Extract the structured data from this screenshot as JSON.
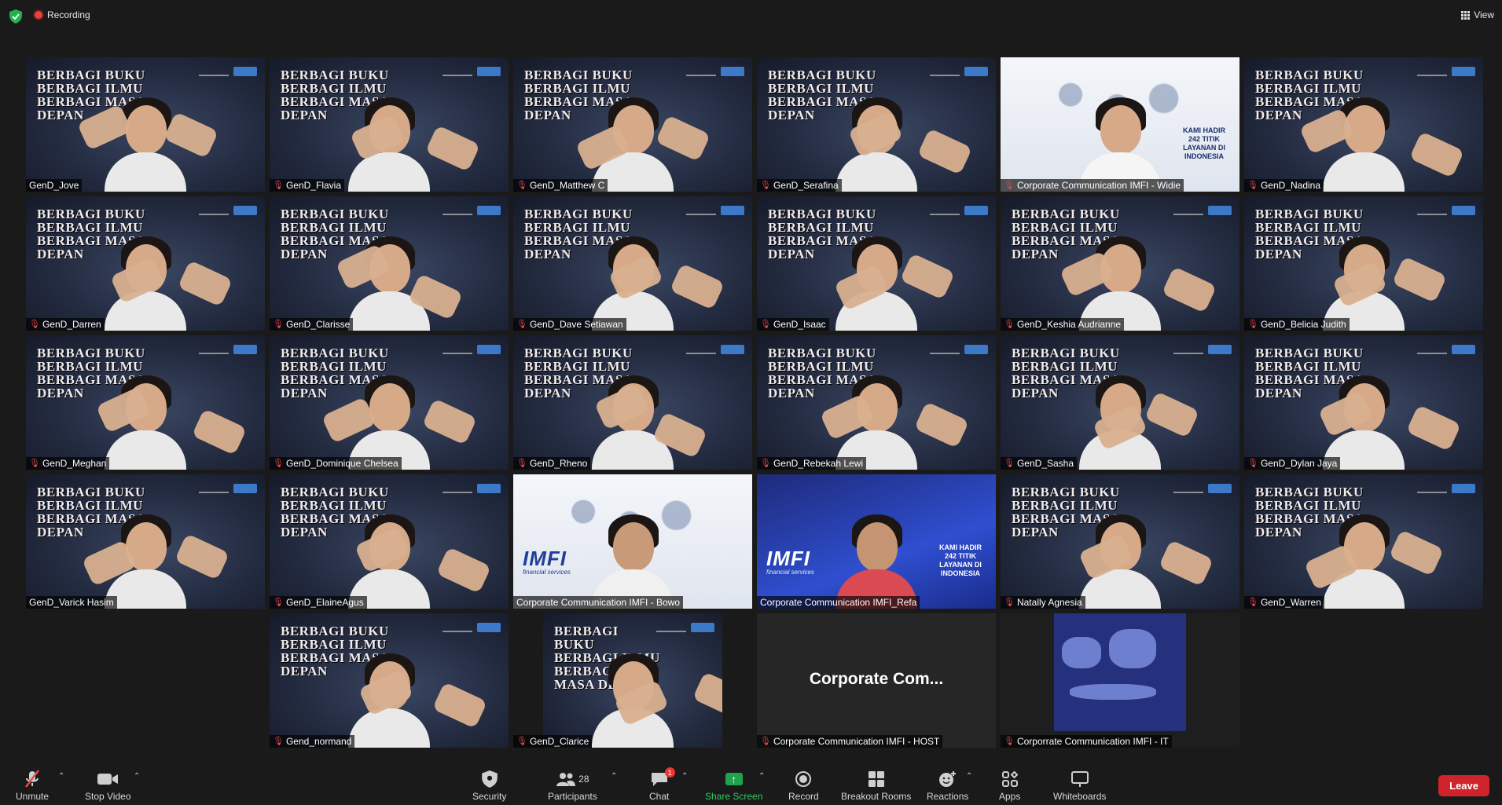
{
  "topbar": {
    "recording_label": "Recording",
    "view_label": "View"
  },
  "participants": [
    {
      "name": "GenD_Jove",
      "muted": false,
      "type": "person"
    },
    {
      "name": "GenD_Flavia",
      "muted": true,
      "type": "person"
    },
    {
      "name": "GenD_Matthew C",
      "muted": true,
      "type": "person"
    },
    {
      "name": "GenD_Serafina",
      "muted": true,
      "type": "person"
    },
    {
      "name": "Corporate Communication IMFI - Widie",
      "muted": true,
      "type": "map"
    },
    {
      "name": "GenD_Nadina",
      "muted": true,
      "type": "person"
    },
    {
      "name": "GenD_Darren",
      "muted": true,
      "type": "person"
    },
    {
      "name": "GenD_Clarisse",
      "muted": true,
      "type": "person"
    },
    {
      "name": "GenD_Dave Setiawan",
      "muted": true,
      "type": "person"
    },
    {
      "name": "GenD_Isaac",
      "muted": true,
      "type": "person"
    },
    {
      "name": "GenD_Keshia Audrianne",
      "muted": true,
      "type": "person"
    },
    {
      "name": "GenD_Belicia Judith",
      "muted": true,
      "type": "person"
    },
    {
      "name": "GenD_Meghan",
      "muted": true,
      "type": "person"
    },
    {
      "name": "GenD_Dominique Chelsea",
      "muted": true,
      "type": "person"
    },
    {
      "name": "GenD_Rheno",
      "muted": true,
      "type": "person"
    },
    {
      "name": "GenD_Rebekah Lewi",
      "muted": true,
      "type": "person"
    },
    {
      "name": "GenD_Sasha",
      "muted": true,
      "type": "person"
    },
    {
      "name": "GenD_Dylan Jaya",
      "muted": true,
      "type": "person"
    },
    {
      "name": "GenD_Varick Hasim",
      "muted": false,
      "type": "person"
    },
    {
      "name": "GenD_ElaineAgus",
      "muted": true,
      "type": "person"
    },
    {
      "name": "Corporate Communication IMFI - Bowo",
      "muted": false,
      "type": "imfi-white",
      "active": true
    },
    {
      "name": "Corporate Communication IMFI_Refa",
      "muted": false,
      "type": "imfi-blue",
      "speaking": true
    },
    {
      "name": "Natally Agnesia",
      "muted": true,
      "type": "person"
    },
    {
      "name": "GenD_Warren",
      "muted": true,
      "type": "person"
    },
    {
      "name": "Gend_normand",
      "muted": true,
      "type": "person"
    },
    {
      "name": "GenD_Clarice",
      "muted": true,
      "type": "narrow"
    },
    {
      "name": "Corporate Communication IMFI - HOST",
      "muted": true,
      "type": "blank",
      "display_name": "Corporate  Com..."
    },
    {
      "name": "Corporrate Communication IMFI - IT",
      "muted": true,
      "type": "mapbox"
    }
  ],
  "banner": {
    "line1": "BERBAGI BUKU",
    "line2": "BERBAGI ILMU",
    "line3": "BERBAGI MASA DEPAN",
    "imfi_logo": "IMFI",
    "imfi_sub": "financial services",
    "kami_text": "KAMI HADIR 242 TITIK LAYANAN DI INDONESIA"
  },
  "toolbar": {
    "unmute": "Unmute",
    "stop_video": "Stop Video",
    "security": "Security",
    "participants": "Participants",
    "participants_count": "28",
    "chat": "Chat",
    "chat_badge": "1",
    "share_screen": "Share Screen",
    "record": "Record",
    "breakout_rooms": "Breakout Rooms",
    "reactions": "Reactions",
    "apps": "Apps",
    "whiteboards": "Whiteboards",
    "leave": "Leave"
  },
  "colors": {
    "active_border": "#e6f25c",
    "leave_red": "#d0242c",
    "share_green": "#1fa44d",
    "mute_red": "#e34b4b"
  }
}
